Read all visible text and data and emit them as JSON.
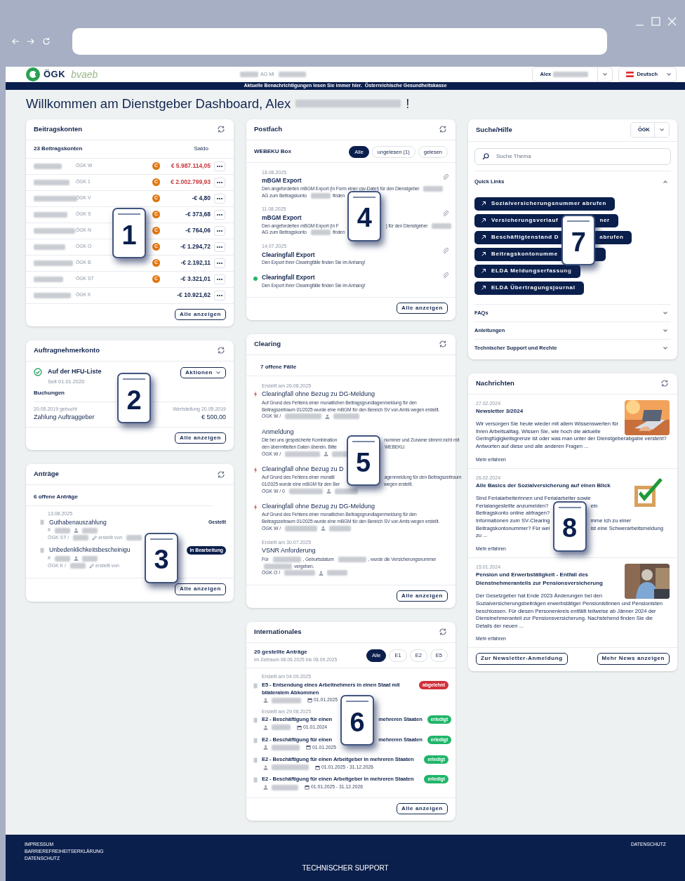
{
  "header": {
    "logo": "ÖGK",
    "logo_sub": "bvaeb",
    "company": [
      {
        "kind": "blur"
      },
      {
        "kind": "text",
        "text": "AG Mi"
      },
      {
        "kind": "blur"
      }
    ],
    "user": "Alex",
    "language": "Deutsch"
  },
  "banner": {
    "text": "Aktuelle Benachrichtigungen lesen Sie immer hier.",
    "link": "Österreichische Gesundheitskasse"
  },
  "welcome": {
    "text": "Willkommen am Dienstgeber Dashboard, Alex",
    "end": "!"
  },
  "beitragskonten": {
    "title": "Beitragskonten",
    "count": "23 Beitragskonten",
    "saldo": "Saldo",
    "button": "Alle anzeigen",
    "rows": [
      {
        "office": "ÖGK W",
        "badge": "C",
        "amount": "€ 5.987.114,05",
        "color": "#c8373c"
      },
      {
        "office": "ÖGK 1",
        "badge": "C",
        "amount": "€ 2.002.799,93",
        "color": "#c8373c"
      },
      {
        "office": "ÖGK V",
        "badge": "C",
        "amount": "-€ 4,80",
        "color": "#13264f"
      },
      {
        "office": "ÖGK S",
        "badge": "C",
        "amount": "-€ 373,68",
        "color": "#13264f"
      },
      {
        "office": "ÖGK N",
        "badge": "C",
        "amount": "-€ 764,06",
        "color": "#13264f"
      },
      {
        "office": "ÖGK O",
        "badge": "C",
        "amount": "-€ 1.294,72",
        "color": "#13264f"
      },
      {
        "office": "ÖGK B",
        "badge": "C",
        "amount": "-€ 2.192,11",
        "color": "#13264f"
      },
      {
        "office": "ÖGK ST",
        "badge": "C",
        "amount": "-€ 3.321,01",
        "color": "#13264f"
      },
      {
        "office": "ÖGK K",
        "amount": "-€ 10.921,62",
        "color": "#13264f"
      }
    ]
  },
  "auftragnehmer": {
    "title": "Auftragnehmerkonto",
    "status": "Auf der HFU-Liste",
    "since": "Seit 01.01.2020",
    "bookings": "Buchungen",
    "actions": "Aktionen",
    "booked": "20.05.2019 gebucht",
    "value_date": "Wertstellung 20.05.2019",
    "payment": "Zahlung Auftraggeber",
    "amount": "€ 500,00",
    "button": "Alle anzeigen"
  },
  "antraege": {
    "title": "Anträge",
    "count": "6 offene Anträge",
    "button": "Alle anzeigen",
    "items": [
      {
        "date": "13.08.2025",
        "title": [
          {
            "kind": "text",
            "text": "Guthabenauszahlung"
          }
        ],
        "line1": [
          {
            "kind": "text",
            "text": "#"
          },
          {
            "kind": "blur"
          },
          {
            "kind": "person"
          },
          {
            "kind": "blur"
          }
        ],
        "line2": [
          {
            "kind": "text",
            "text": "ÖGK ST /"
          },
          {
            "kind": "blur"
          },
          {
            "kind": "pencil"
          },
          {
            "kind": "text",
            "text": "erstellt von"
          },
          {
            "kind": "blur"
          },
          {
            "kind": "hidden"
          }
        ],
        "status": "Gestellt",
        "kind": "plain"
      },
      {
        "title": [
          {
            "kind": "text",
            "text": "Unbedenklichkeitsbescheinigu"
          },
          {
            "kind": "hidden"
          }
        ],
        "line1": [
          {
            "kind": "text",
            "text": "#"
          },
          {
            "kind": "blur"
          },
          {
            "kind": "person"
          },
          {
            "kind": "blur"
          }
        ],
        "line2": [
          {
            "kind": "text",
            "text": "ÖGK K /"
          },
          {
            "kind": "blur"
          },
          {
            "kind": "pencil"
          },
          {
            "kind": "text",
            "text": "erstellt von"
          },
          {
            "kind": "hidden"
          }
        ],
        "status": "In Bearbeitung",
        "kind": "pill"
      }
    ]
  },
  "postfach": {
    "title": "Postfach",
    "box": "WEBEKU Box",
    "button": "Alle anzeigen",
    "filters": [
      {
        "label": "Alle",
        "selected": true
      },
      {
        "label": "ungelesen (1)",
        "selected": false
      },
      {
        "label": "gelesen",
        "selected": false
      }
    ],
    "items": [
      {
        "date": "18.08.2025",
        "title": "mBGM Export",
        "lines": [
          [
            {
              "kind": "text",
              "text": "Den angeforderten mBGM Export (in Form einer csv-Datei) für den Dienstgeber"
            },
            {
              "kind": "blur"
            }
          ],
          [
            {
              "kind": "text",
              "text": "AG zum Beitragskonto"
            },
            {
              "kind": "blur"
            },
            {
              "kind": "text",
              "text": "finden"
            },
            {
              "kind": "hidden"
            }
          ]
        ],
        "attachment": true,
        "unread": false
      },
      {
        "date": "11.08.2025",
        "title": "mBGM Export",
        "lines": [
          [
            {
              "kind": "text",
              "text": "Den angeforderten mBGM Export (in F"
            },
            {
              "kind": "hidden"
            },
            {
              "kind": "text",
              "text": ") für den Dienstgeber"
            },
            {
              "kind": "blur"
            }
          ],
          [
            {
              "kind": "text",
              "text": "AG zum Beitragskonto"
            },
            {
              "kind": "blur"
            },
            {
              "kind": "text",
              "text": "finden"
            },
            {
              "kind": "hidden"
            }
          ]
        ],
        "attachment": true,
        "unread": false
      },
      {
        "date": "14.07.2025",
        "title": "Clearingfall Export",
        "desc": "Den Export Ihrer Clearingfälle finden Sie im Anhang!",
        "attachment": true,
        "unread": false
      },
      {
        "title": "Clearingfall Export",
        "desc": "Den Export Ihrer Clearingfälle finden Sie im Anhang!",
        "attachment": true,
        "unread": true
      }
    ]
  },
  "clearing": {
    "title": "Clearing",
    "count": "7 offene Fälle",
    "button": "Alle anzeigen",
    "items": [
      {
        "created": "Erstellt am 26.08.2025",
        "urgent": true,
        "title": [
          {
            "kind": "text",
            "text": "Clearingfall ohne Bezug zu DG-Meldung"
          }
        ],
        "desc": "Auf Grund des Fehlens einer monatlichen Beitragsgrundlagenmeldung für den Beitragszeitraum 01/2025 wurde eine mBGM für den Bereich SV von Amts wegen erstellt.",
        "meta": [
          {
            "kind": "text",
            "text": "ÖGK W /"
          },
          {
            "kind": "blur"
          },
          {
            "kind": "person"
          },
          {
            "kind": "blur"
          }
        ]
      },
      {
        "urgent": false,
        "title": [
          {
            "kind": "text",
            "text": "Anmeldung"
          }
        ],
        "lines": [
          [
            {
              "kind": "text",
              "text": "Die bei uns gespeicherte Kombination"
            },
            {
              "kind": "hidden"
            },
            {
              "kind": "text",
              "text": "nummer und Zuname stimmt nicht mit"
            }
          ],
          [
            {
              "kind": "text",
              "text": "den übermittelten Daten überein. Bitte"
            },
            {
              "kind": "hidden"
            },
            {
              "kind": "text",
              "text": "WEBEKU."
            }
          ]
        ],
        "meta": [
          {
            "kind": "text",
            "text": "ÖGK W /"
          },
          {
            "kind": "blur"
          },
          {
            "kind": "person"
          },
          {
            "kind": "blur"
          }
        ]
      },
      {
        "urgent": true,
        "title": [
          {
            "kind": "text",
            "text": "Clearingfall ohne Bezug zu D"
          },
          {
            "kind": "hidden"
          }
        ],
        "lines": [
          [
            {
              "kind": "text",
              "text": "Auf Grund des Fehlens einer monatli"
            },
            {
              "kind": "hidden"
            },
            {
              "kind": "text",
              "text": "agenmeldung für den Beitragszeitraum"
            }
          ],
          [
            {
              "kind": "text",
              "text": "01/2025 wurde eine mBGM für den Ber"
            },
            {
              "kind": "hidden"
            },
            {
              "kind": "text",
              "text": "wegen erstellt."
            }
          ]
        ],
        "meta": [
          {
            "kind": "text",
            "text": "ÖGK W / 0"
          },
          {
            "kind": "blur"
          },
          {
            "kind": "person"
          },
          {
            "kind": "blur"
          }
        ]
      },
      {
        "urgent": true,
        "title": [
          {
            "kind": "text",
            "text": "Clearingfall ohne Bezug zu DG-Meldung"
          }
        ],
        "desc": "Auf Grund des Fehlens einer monatlichen Beitragsgrundlagenmeldung für den Beitragszeitraum 01/2025 wurde eine mBGM für den Bereich SV von Amts wegen erstellt.",
        "meta": [
          {
            "kind": "text",
            "text": "ÖGK W /"
          },
          {
            "kind": "blur"
          },
          {
            "kind": "person"
          },
          {
            "kind": "blur"
          }
        ]
      },
      {
        "created": "Erstellt am 30.07.2025",
        "urgent": false,
        "title": [
          {
            "kind": "text",
            "text": "VSNR Anforderung"
          }
        ],
        "lines": [
          [
            {
              "kind": "text",
              "text": "Für"
            },
            {
              "kind": "blur"
            },
            {
              "kind": "text",
              "text": ", Geburtsdatum"
            },
            {
              "kind": "blur"
            },
            {
              "kind": "text",
              "text": ", wurde die Versicherungsnummer"
            }
          ],
          [
            {
              "kind": "blur"
            },
            {
              "kind": "text",
              "text": "vergeben."
            }
          ]
        ],
        "meta": [
          {
            "kind": "text",
            "text": "ÖGK O /"
          },
          {
            "kind": "blur"
          },
          {
            "kind": "person"
          },
          {
            "kind": "blur"
          }
        ]
      }
    ]
  },
  "internationales": {
    "title": "Internationales",
    "count": "20 gestellte Anträge",
    "period": "im Zeitraum 08.06.2025 bis 08.09.2025",
    "button": "Alle anzeigen",
    "filters": [
      {
        "label": "Alle",
        "selected": true
      },
      {
        "label": "E1",
        "selected": false
      },
      {
        "label": "E2",
        "selected": false
      },
      {
        "label": "E5",
        "selected": false
      }
    ],
    "items": [
      {
        "created": "Erstellt am 04.09.2025",
        "title": [
          {
            "kind": "text",
            "text": "E5 - Entsendung eines Arbeitnehmers in einen Staat mit bilateralem Abkommen"
          }
        ],
        "status": "abgelehnt",
        "color": "#d0313a",
        "meta": [
          {
            "kind": "person"
          },
          {
            "kind": "blur"
          },
          {
            "kind": "calendar"
          },
          {
            "kind": "text",
            "text": "01.01.2025"
          },
          {
            "kind": "hidden"
          }
        ]
      },
      {
        "created": "Erstellt am 29.08.2025",
        "title": [
          {
            "kind": "text",
            "text": "E2 - Beschäftigung für einen"
          },
          {
            "kind": "hidden"
          },
          {
            "kind": "text",
            "text": "mehreren Staaten"
          }
        ],
        "status": "erledigt",
        "color": "#1fb56a",
        "meta": [
          {
            "kind": "person"
          },
          {
            "kind": "blur"
          },
          {
            "kind": "calendar"
          },
          {
            "kind": "text",
            "text": "01.01.2024"
          },
          {
            "kind": "hidden"
          }
        ]
      },
      {
        "title": [
          {
            "kind": "text",
            "text": "E2 - Beschäftigung für einen"
          },
          {
            "kind": "hidden"
          },
          {
            "kind": "text",
            "text": "mehreren Staaten"
          }
        ],
        "status": "erledigt",
        "color": "#1fb56a",
        "meta": [
          {
            "kind": "person"
          },
          {
            "kind": "blur"
          },
          {
            "kind": "calendar"
          },
          {
            "kind": "text",
            "text": "01.01.2025"
          },
          {
            "kind": "hidden"
          }
        ]
      },
      {
        "title": [
          {
            "kind": "text",
            "text": "E2 - Beschäftigung für einen Arbeitgeber in mehreren Staaten"
          }
        ],
        "status": "erledigt",
        "color": "#1fb56a",
        "meta": [
          {
            "kind": "person"
          },
          {
            "kind": "blur"
          },
          {
            "kind": "calendar"
          },
          {
            "kind": "text",
            "text": "01.01.2025 - 31.12.2026"
          }
        ]
      },
      {
        "title": [
          {
            "kind": "text",
            "text": "E2 - Beschäftigung für einen Arbeitgeber in mehreren Staaten"
          }
        ],
        "status": "erledigt",
        "color": "#1fb56a",
        "meta": [
          {
            "kind": "person"
          },
          {
            "kind": "blur"
          },
          {
            "kind": "calendar"
          },
          {
            "kind": "text",
            "text": "01.01.2025 - 31.12.2026"
          }
        ]
      }
    ]
  },
  "suche": {
    "title": "Suche/Hilfe",
    "scope": "ÖGK",
    "placeholder": "Suche Thema",
    "sections": [
      {
        "title": "Quick Links",
        "expanded": true,
        "links": [
          [
            {
              "kind": "text",
              "text": "Sozialversicherungsnummer abrufen"
            }
          ],
          [
            {
              "kind": "text",
              "text": "Versicherungsverlauf"
            },
            {
              "kind": "hidden"
            },
            {
              "kind": "text",
              "text": "ner"
            }
          ],
          [
            {
              "kind": "text",
              "text": "Beschäftigtenstand D"
            },
            {
              "kind": "hidden"
            },
            {
              "kind": "text",
              "text": "abrufen"
            }
          ],
          [
            {
              "kind": "text",
              "text": "Beitragskontonumme"
            },
            {
              "kind": "hidden"
            }
          ],
          [
            {
              "kind": "text",
              "text": "ELDA Meldungserfassung"
            }
          ],
          [
            {
              "kind": "text",
              "text": "ELDA Übertragungsjournal"
            }
          ]
        ]
      },
      {
        "title": "FAQs",
        "expanded": false
      },
      {
        "title": "Anleitungen",
        "expanded": false
      },
      {
        "title": "Technischer Support und Rechte",
        "expanded": false
      }
    ]
  },
  "nachrichten": {
    "title": "Nachrichten",
    "buttons": [
      "Zur Newsletter-Anmeldung",
      "Mehr News anzeigen"
    ],
    "items": [
      {
        "date": "27.02.2024",
        "title": "Newsletter 3/2024",
        "text": "Wir versorgen Sie heute wieder mit allem Wissenswerten für Ihren Arbeitsalltag. Wissen Sie, wie hoch die aktuelle Geringfügigkeitsgrenze ist oder was man unter der Dienstgeberabgabe versteht? Antworten auf diese und alle anderen Fragen ...",
        "more": "Mehr erfahren",
        "picture": {
          "kind": "picture"
        }
      },
      {
        "date": "26.02.2024",
        "title": "Alle Basics der Sozialversicherung auf einen Blick",
        "lines": [
          [
            {
              "kind": "text",
              "text": "Sind Ferialarbeiterinnen und Ferialarbeiter sowie"
            }
          ],
          [
            {
              "kind": "text",
              "text": "Ferialangestellte anzumelden?"
            },
            {
              "kind": "hidden"
            },
            {
              "kind": "text",
              "text": "ein"
            }
          ],
          [
            {
              "kind": "text",
              "text": "Beitragskonto online abfragen?"
            },
            {
              "kind": "hidden"
            }
          ],
          [
            {
              "kind": "text",
              "text": "Informationen zum SV-Clearing"
            },
            {
              "kind": "hidden"
            },
            {
              "kind": "text",
              "text": "mme ich zu einer"
            }
          ],
          [
            {
              "kind": "text",
              "text": "Beitragskontonummer? Für wel"
            },
            {
              "kind": "hidden"
            },
            {
              "kind": "text",
              "text": "ist eine Schwerarbeitsmeldung"
            }
          ],
          [
            {
              "kind": "text",
              "text": "zu ..."
            }
          ]
        ],
        "more": "Mehr erfahren",
        "picture": {
          "kind": "picture"
        }
      },
      {
        "date": "15.01.2024",
        "title": "Pension und Erwerbstätigkeit - Entfall des Dienstnehmeranteils zur Pensionsversicherung",
        "text": "Der Gesetzgeber hat Ende 2023 Änderungen bei den Sozialversicherungsbeiträgen erwerbstätiger Pensionistinnen und Pensionisten beschlossen. Für diesen Personenkreis entfällt teilweise ab Jänner 2024 der Dienstnehmeranteil zur Pensionsversicherung. Nachstehend finden Sie die Details der neuen ...",
        "more": "Mehr erfahren",
        "picture": {
          "kind": "picture"
        }
      }
    ]
  },
  "callouts": [
    "1",
    "2",
    "3",
    "4",
    "5",
    "6",
    "7",
    "8"
  ],
  "footer": {
    "links": [
      "IMPRESSUM",
      "BARRIEREFREIHEITSERKLÄRUNG",
      "DATENSCHUTZ"
    ],
    "right_link": "DATENSCHUTZ",
    "support": "TECHNISCHER SUPPORT"
  }
}
